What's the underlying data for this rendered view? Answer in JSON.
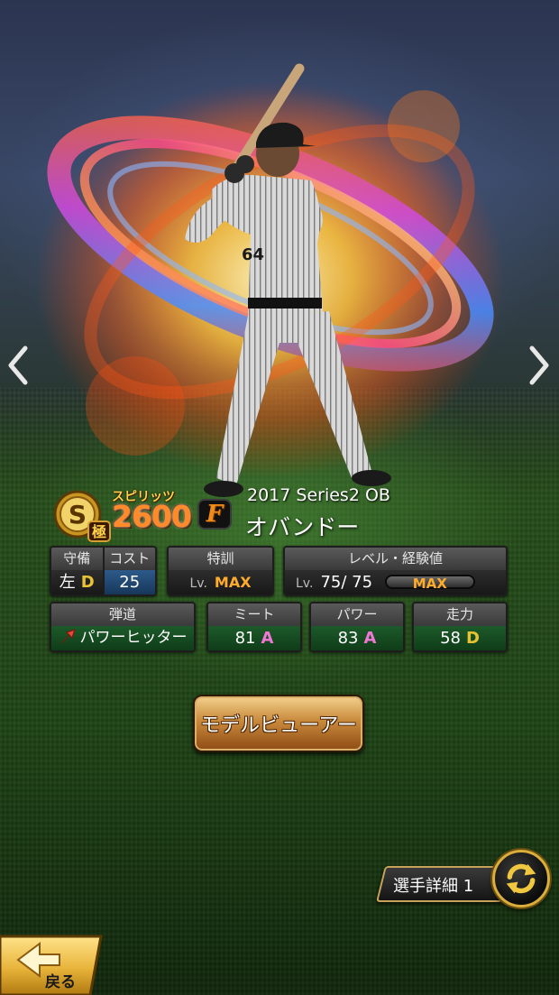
{
  "card": {
    "rank": "S",
    "rank_sub": "極",
    "spirits_label": "スピリッツ",
    "spirits_value": "2600",
    "team_logo": "F",
    "series": "2017 Series2 OB",
    "player_name": "オバンドー",
    "jersey_number": "64"
  },
  "stats_row1": {
    "position_header": "守備",
    "position_value": "左",
    "position_grade": "D",
    "cost_header": "コスト",
    "cost_value": "25",
    "training_header": "特訓",
    "training_lv": "Lv.",
    "training_value": "MAX",
    "level_header": "レベル・経験値",
    "level_lv": "Lv.",
    "level_value": "75/ 75",
    "exp_label": "MAX",
    "exp_fraction": 1.0
  },
  "stats_row2": {
    "trajectory_header": "弾道",
    "trajectory_value": "パワーヒッター",
    "contact_header": "ミート",
    "contact_value": "81",
    "contact_grade": "A",
    "power_header": "パワー",
    "power_value": "83",
    "power_grade": "A",
    "speed_header": "走力",
    "speed_value": "58",
    "speed_grade": "D"
  },
  "buttons": {
    "model_viewer": "モデルビューアー",
    "player_detail": "選手詳細 1",
    "back": "戻る"
  },
  "icons": {
    "prev": "chevron-left-icon",
    "next": "chevron-right-icon",
    "swap": "swap-arrows-icon",
    "back": "back-arrow-icon",
    "trajectory": "trajectory-arrow-icon"
  },
  "colors": {
    "grade_d": "#e8c234",
    "grade_a": "#ef78d4",
    "max": "#ffab2b",
    "spirits": "#ff8a2a"
  }
}
